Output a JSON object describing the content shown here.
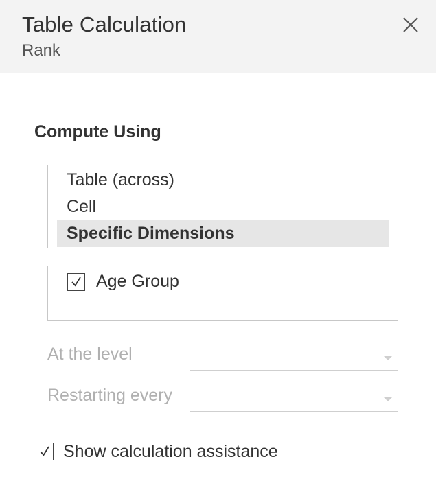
{
  "header": {
    "title": "Table Calculation",
    "subtitle": "Rank"
  },
  "compute_using": {
    "label": "Compute Using",
    "options": [
      {
        "label": "Table (across)",
        "selected": false
      },
      {
        "label": "Cell",
        "selected": false
      },
      {
        "label": "Specific Dimensions",
        "selected": true
      }
    ],
    "dimensions": [
      {
        "label": "Age Group",
        "checked": true
      }
    ]
  },
  "at_the_level": {
    "label": "At the level",
    "value": ""
  },
  "restarting_every": {
    "label": "Restarting every",
    "value": ""
  },
  "assistance": {
    "label": "Show calculation assistance",
    "checked": true
  },
  "colors": {
    "header_bg": "#f3f3f3",
    "selected_bg": "#e6e6e6",
    "disabled_text": "#b0b0b0"
  }
}
